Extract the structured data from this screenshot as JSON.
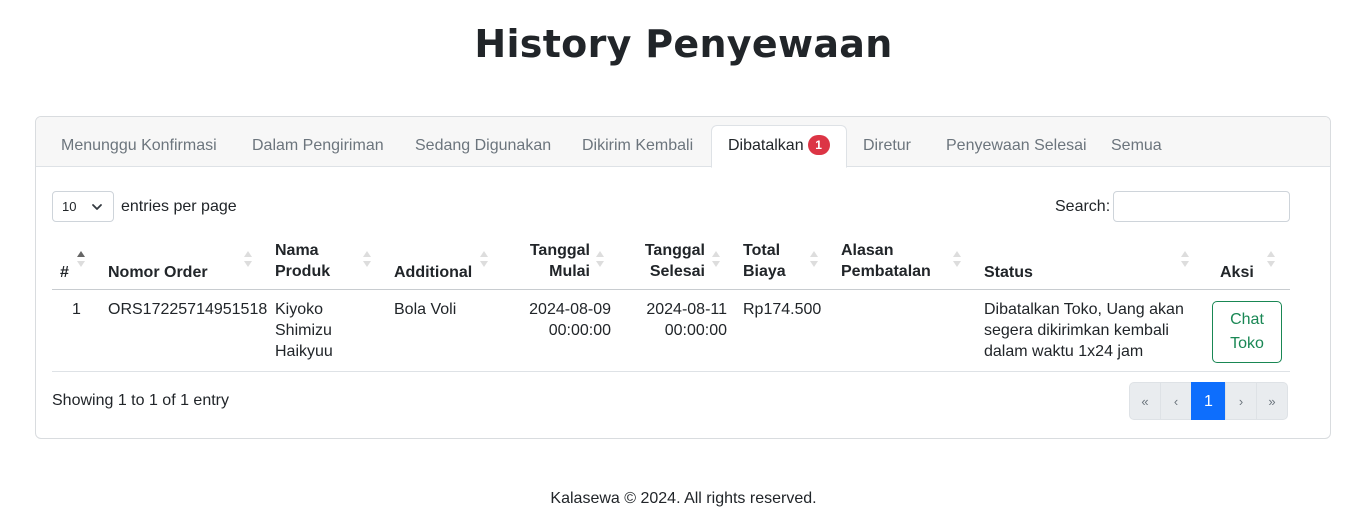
{
  "page": {
    "title": "History Penyewaan"
  },
  "tabs": [
    {
      "label": "Menunggu Konfirmasi"
    },
    {
      "label": "Dalam Pengiriman"
    },
    {
      "label": "Sedang Digunakan"
    },
    {
      "label": "Dikirim Kembali"
    },
    {
      "label": "Dibatalkan",
      "badge": "1",
      "active": true
    },
    {
      "label": "Diretur"
    },
    {
      "label": "Penyewaan Selesai"
    },
    {
      "label": "Semua"
    }
  ],
  "controls": {
    "entries_value": "10",
    "entries_label": "entries per page",
    "search_label": "Search:",
    "search_value": ""
  },
  "table": {
    "headers": {
      "no": "#",
      "order": "Nomor Order",
      "produk_1": "Nama",
      "produk_2": "Produk",
      "additional": "Additional",
      "mulai_1": "Tanggal",
      "mulai_2": "Mulai",
      "selesai_1": "Tanggal",
      "selesai_2": "Selesai",
      "biaya_1": "Total",
      "biaya_2": "Biaya",
      "alasan_1": "Alasan",
      "alasan_2": "Pembatalan",
      "status": "Status",
      "aksi": "Aksi"
    },
    "rows": [
      {
        "no": "1",
        "order": "ORS17225714951518",
        "produk": [
          "Kiyoko",
          "Shimizu",
          "Haikyuu"
        ],
        "additional": "Bola Voli",
        "mulai": [
          "2024-08-09",
          "00:00:00"
        ],
        "selesai": [
          "2024-08-11",
          "00:00:00"
        ],
        "biaya": "Rp174.500",
        "alasan": "",
        "status": [
          "Dibatalkan Toko, Uang akan",
          "segera dikirimkan kembali",
          "dalam waktu 1x24 jam"
        ],
        "action": [
          "Chat",
          "Toko"
        ]
      }
    ]
  },
  "pagination": {
    "info": "Showing 1 to 1 of 1 entry",
    "first": "«",
    "prev": "‹",
    "current": "1",
    "next": "›",
    "last": "»"
  },
  "footer": {
    "text": "Kalasewa © 2024. All rights reserved."
  },
  "colors": {
    "accent": "#0d6efd",
    "badge": "#dc3545",
    "chat_button": "#198754"
  }
}
